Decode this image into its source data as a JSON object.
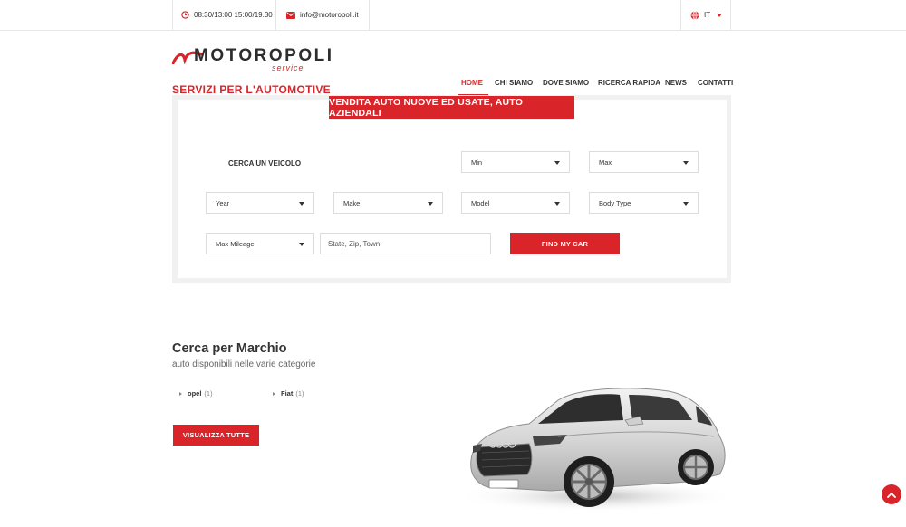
{
  "topbar": {
    "hours": "08:30/13:00 15:00/19.30",
    "email": "info@motoropoli.it",
    "language": "IT"
  },
  "logo": {
    "name": "MOTOROPOLI",
    "sub": "service"
  },
  "tagline": "SERVIZI PER L'AUTOMOTIVE",
  "nav": {
    "items": [
      {
        "label": "HOME"
      },
      {
        "label": "CHI SIAMO"
      },
      {
        "label": "DOVE SIAMO"
      },
      {
        "label": "RICERCA RAPIDA"
      },
      {
        "label": "NEWS"
      },
      {
        "label": "CONTATTI"
      }
    ]
  },
  "search": {
    "banner": "VENDITA AUTO NUOVE ED USATE, AUTO AZIENDALI",
    "label": "CERCA UN VEICOLO",
    "min": "Min",
    "max": "Max",
    "year": "Year",
    "make": "Make",
    "model": "Model",
    "body_type": "Body Type",
    "max_mileage": "Max Mileage",
    "location_placeholder": "State, Zip, Town",
    "submit": "FIND MY CAR"
  },
  "brands": {
    "title": "Cerca per Marchio",
    "subtitle": "auto disponibili nelle varie categorie",
    "items": [
      {
        "name": "opel",
        "count": "(1)"
      },
      {
        "name": "Fiat",
        "count": "(1)"
      }
    ],
    "view_all": "VISUALIZZA TUTTE"
  },
  "colors": {
    "accent": "#d9252a",
    "text": "#333333"
  },
  "icons": {
    "hours": "clock-icon",
    "email": "envelope-icon",
    "language": "globe-icon",
    "scroll": "chevron-up-icon"
  }
}
